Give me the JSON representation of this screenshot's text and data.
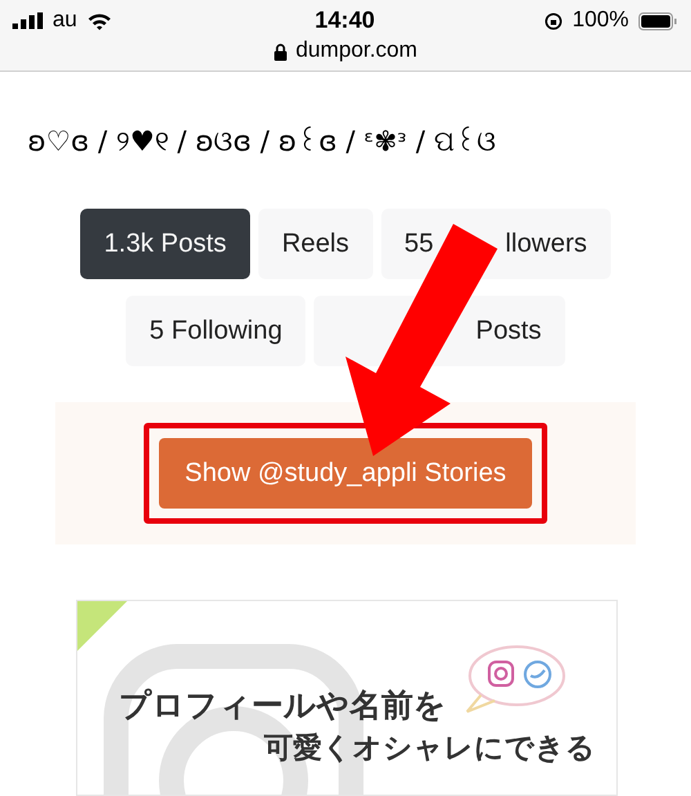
{
  "status_bar": {
    "carrier": "au",
    "time": "14:40",
    "battery": "100%",
    "url": "dumpor.com"
  },
  "bio": "ʚ♡ɞ / ୨♥୧ / ʚଓɞ / ʚ꒰ɞ / ᵋ✾ᵌ / ପ꒰ଓ",
  "tabs": [
    {
      "label": "1.3k Posts",
      "selected": true
    },
    {
      "label": "Reels",
      "selected": false
    },
    {
      "visible_start": "55",
      "visible_end": "llowers",
      "selected": false
    },
    {
      "label": "5 Following",
      "selected": false
    },
    {
      "visible_end": "Posts",
      "selected": false
    }
  ],
  "stories_button": "Show @study_appli Stories",
  "banner": {
    "line_1": "プロフィールや名前を",
    "line_2": "可愛くオシャレにできる"
  }
}
